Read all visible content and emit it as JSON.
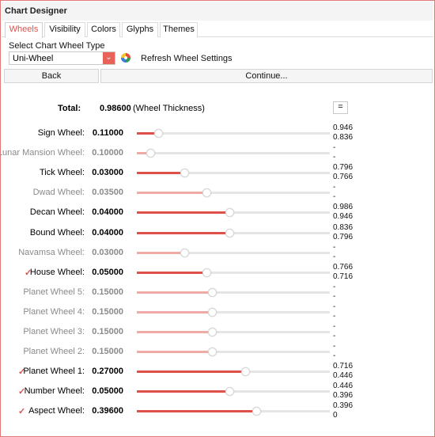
{
  "window": {
    "title": "Chart Designer"
  },
  "tabs": [
    {
      "label": "Wheels",
      "active": true
    },
    {
      "label": "Visibility",
      "active": false
    },
    {
      "label": "Colors",
      "active": false
    },
    {
      "label": "Glyphs",
      "active": false
    },
    {
      "label": "Themes",
      "active": false
    }
  ],
  "wheel_type": {
    "label": "Select Chart Wheel Type",
    "selected": "Uni-Wheel",
    "refresh_label": "Refresh Wheel Settings"
  },
  "buttons": {
    "back": "Back",
    "continue": "Continue..."
  },
  "total": {
    "label": "Total:",
    "value": "0.98600",
    "note": "(Wheel Thickness)",
    "equals_label": "="
  },
  "colors": {
    "accent": "#e0504a",
    "accent_disabled": "#efaaa6",
    "track": "#e5e5e5"
  },
  "wheels": [
    {
      "name": "Sign Wheel:",
      "value": "0.11000",
      "fraction": 0.11,
      "enabled": true,
      "checkbox": false,
      "range_top": "0.946",
      "range_bottom": "0.836"
    },
    {
      "name": "Lunar Mansion Wheel:",
      "value": "0.10000",
      "fraction": 0.07,
      "enabled": false,
      "checkbox": false,
      "range_top": "-",
      "range_bottom": "-"
    },
    {
      "name": "Tick Wheel:",
      "value": "0.03000",
      "fraction": 0.245,
      "enabled": true,
      "checkbox": false,
      "range_top": "0.796",
      "range_bottom": "0.766"
    },
    {
      "name": "Dwad Wheel:",
      "value": "0.03500",
      "fraction": 0.36,
      "enabled": false,
      "checkbox": false,
      "range_top": "-",
      "range_bottom": "-"
    },
    {
      "name": "Decan Wheel:",
      "value": "0.04000",
      "fraction": 0.48,
      "enabled": true,
      "checkbox": false,
      "range_top": "0.986",
      "range_bottom": "0.946"
    },
    {
      "name": "Bound Wheel:",
      "value": "0.04000",
      "fraction": 0.48,
      "enabled": true,
      "checkbox": false,
      "range_top": "0.836",
      "range_bottom": "0.796"
    },
    {
      "name": "Navamsa Wheel:",
      "value": "0.03000",
      "fraction": 0.245,
      "enabled": false,
      "checkbox": false,
      "range_top": "-",
      "range_bottom": "-"
    },
    {
      "name": "House Wheel:",
      "value": "0.05000",
      "fraction": 0.36,
      "enabled": true,
      "checkbox": true,
      "range_top": "0.766",
      "range_bottom": "0.716"
    },
    {
      "name": "Planet Wheel 5:",
      "value": "0.15000",
      "fraction": 0.39,
      "enabled": false,
      "checkbox": false,
      "range_top": "-",
      "range_bottom": "-"
    },
    {
      "name": "Planet Wheel 4:",
      "value": "0.15000",
      "fraction": 0.39,
      "enabled": false,
      "checkbox": false,
      "range_top": "-",
      "range_bottom": "-"
    },
    {
      "name": "Planet Wheel 3:",
      "value": "0.15000",
      "fraction": 0.39,
      "enabled": false,
      "checkbox": false,
      "range_top": "-",
      "range_bottom": "-"
    },
    {
      "name": "Planet Wheel 2:",
      "value": "0.15000",
      "fraction": 0.39,
      "enabled": false,
      "checkbox": false,
      "range_top": "-",
      "range_bottom": "-"
    },
    {
      "name": "Planet Wheel 1:",
      "value": "0.27000",
      "fraction": 0.56,
      "enabled": true,
      "checkbox": true,
      "range_top": "0.716",
      "range_bottom": "0.446"
    },
    {
      "name": "Number Wheel:",
      "value": "0.05000",
      "fraction": 0.48,
      "enabled": true,
      "checkbox": true,
      "range_top": "0.446",
      "range_bottom": "0.396"
    },
    {
      "name": "Aspect Wheel:",
      "value": "0.39600",
      "fraction": 0.62,
      "enabled": true,
      "checkbox": true,
      "range_top": "0.396",
      "range_bottom": "0"
    }
  ]
}
